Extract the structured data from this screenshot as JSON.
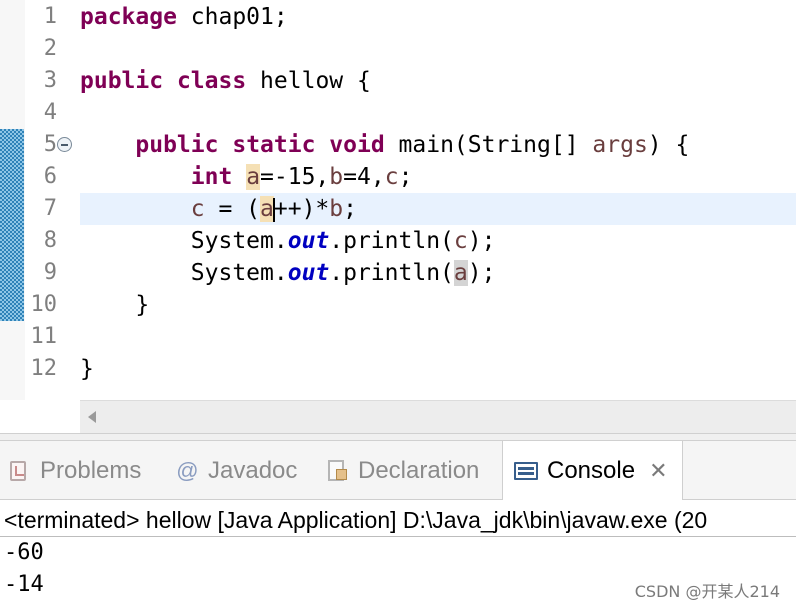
{
  "editor": {
    "line_numbers": [
      "1",
      "2",
      "3",
      "4",
      "5",
      "6",
      "7",
      "8",
      "9",
      "10",
      "11",
      "12"
    ],
    "lines": [
      {
        "tokens": [
          {
            "t": "package",
            "c": "kw"
          },
          {
            "t": " chap01;"
          }
        ]
      },
      {
        "tokens": []
      },
      {
        "tokens": [
          {
            "t": "public",
            "c": "kw"
          },
          {
            "t": " "
          },
          {
            "t": "class",
            "c": "kw"
          },
          {
            "t": " hellow {"
          }
        ]
      },
      {
        "tokens": []
      },
      {
        "tokens": [
          {
            "t": "    "
          },
          {
            "t": "public",
            "c": "kw"
          },
          {
            "t": " "
          },
          {
            "t": "static",
            "c": "kw"
          },
          {
            "t": " "
          },
          {
            "t": "void",
            "c": "kw"
          },
          {
            "t": " main(String[] "
          },
          {
            "t": "args",
            "c": "var"
          },
          {
            "t": ") {"
          }
        ]
      },
      {
        "tokens": [
          {
            "t": "        "
          },
          {
            "t": "int",
            "c": "kw"
          },
          {
            "t": " "
          },
          {
            "t": "a",
            "c": "var occ-w"
          },
          {
            "t": "=-15,"
          },
          {
            "t": "b",
            "c": "var"
          },
          {
            "t": "=4,"
          },
          {
            "t": "c",
            "c": "var"
          },
          {
            "t": ";"
          }
        ]
      },
      {
        "current": true,
        "tokens": [
          {
            "t": "        "
          },
          {
            "t": "c",
            "c": "var"
          },
          {
            "t": " = ("
          },
          {
            "t": "a",
            "c": "var occ-w",
            "caret": true
          },
          {
            "t": "++)*"
          },
          {
            "t": "b",
            "c": "var"
          },
          {
            "t": ";"
          }
        ]
      },
      {
        "tokens": [
          {
            "t": "        System."
          },
          {
            "t": "out",
            "c": "fld"
          },
          {
            "t": ".println("
          },
          {
            "t": "c",
            "c": "var"
          },
          {
            "t": ");"
          }
        ]
      },
      {
        "tokens": [
          {
            "t": "        System."
          },
          {
            "t": "out",
            "c": "fld"
          },
          {
            "t": ".println("
          },
          {
            "t": "a",
            "c": "var occ-r"
          },
          {
            "t": ");"
          }
        ]
      },
      {
        "tokens": [
          {
            "t": "    }"
          }
        ]
      },
      {
        "tokens": []
      },
      {
        "tokens": [
          {
            "t": "}"
          }
        ]
      }
    ]
  },
  "views": {
    "tabs": [
      {
        "label": "Problems",
        "icon": "problems-icon",
        "active": false
      },
      {
        "label": "Javadoc",
        "icon": "javadoc-icon",
        "active": false
      },
      {
        "label": "Declaration",
        "icon": "declaration-icon",
        "active": false
      },
      {
        "label": "Console",
        "icon": "console-icon",
        "active": true
      }
    ],
    "javadoc_glyph": "@",
    "close_glyph": "✕"
  },
  "console": {
    "status": "<terminated> hellow [Java Application] D:\\Java_jdk\\bin\\javaw.exe (20",
    "output": [
      "-60",
      "-14"
    ]
  },
  "watermark": "CSDN @开某人214",
  "colors": {
    "keyword": "#7f0055",
    "field": "#0000c0",
    "variable": "#6a3e3e",
    "current_line": "#e8f2fe",
    "occurrence_write": "#f5e0b5",
    "occurrence_read": "#d4d4d4"
  }
}
